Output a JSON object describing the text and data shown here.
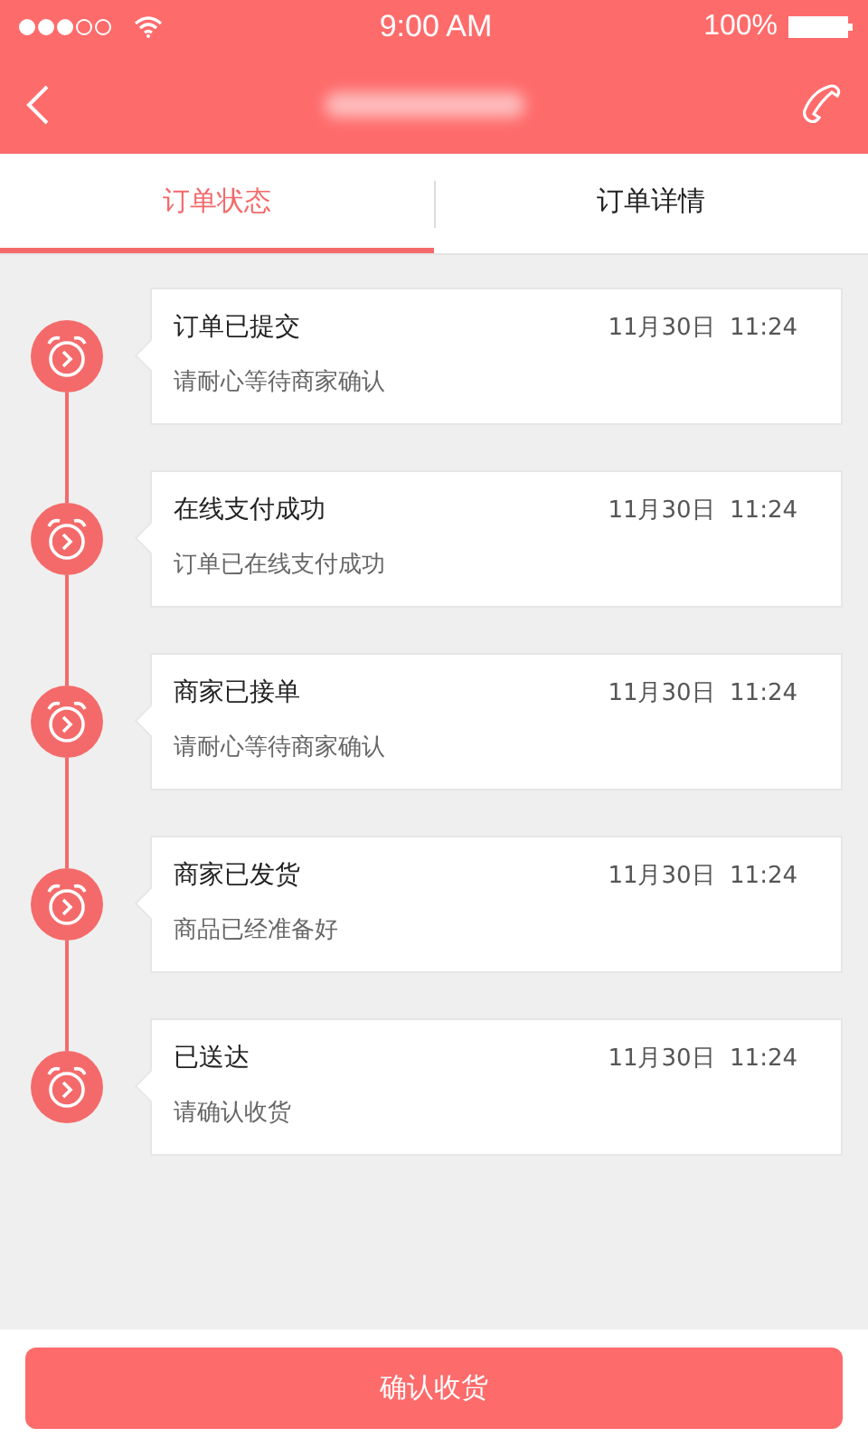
{
  "status_bar": {
    "time": "9:00 AM",
    "battery": "100%"
  },
  "tabs": [
    {
      "label": "订单状态",
      "selected": true
    },
    {
      "label": "订单详情",
      "selected": false
    }
  ],
  "timeline": [
    {
      "title": "订单已提交",
      "time": "11月30日  11:24",
      "note": "请耐心等待商家确认"
    },
    {
      "title": "在线支付成功",
      "time": "11月30日  11:24",
      "note": "订单已在线支付成功"
    },
    {
      "title": "商家已接单",
      "time": "11月30日  11:24",
      "note": "请耐心等待商家确认"
    },
    {
      "title": "商家已发货",
      "time": "11月30日  11:24",
      "note": "商品已经准备好"
    },
    {
      "title": "已送达",
      "time": "11月30日  11:24",
      "note": "请确认收货"
    }
  ],
  "confirm_button": "确认收货"
}
